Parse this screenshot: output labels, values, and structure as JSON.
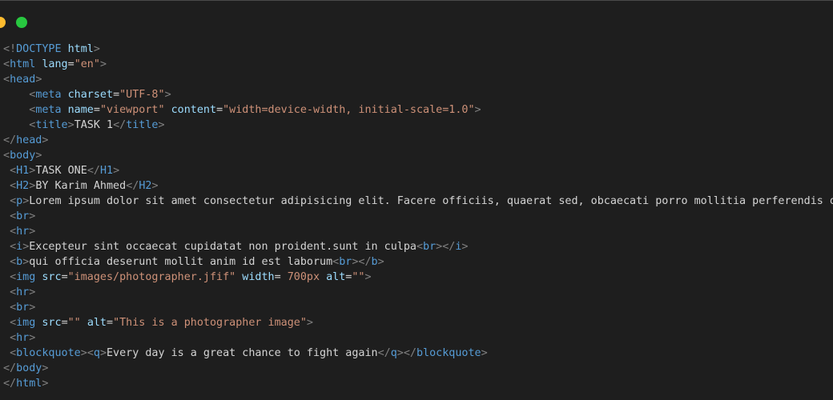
{
  "window": {
    "controls": [
      "minimize-control",
      "zoom-control"
    ]
  },
  "code": {
    "lines": [
      "<!DOCTYPE html>",
      "<html lang=\"en\">",
      "<head>",
      "    <meta charset=\"UTF-8\">",
      "    <meta name=\"viewport\" content=\"width=device-width, initial-scale=1.0\">",
      "    <title>TASK 1</title>",
      "</head>",
      "<body>",
      " <H1>TASK ONE</H1>",
      " <H2>BY Karim Ahmed</H2>",
      " <p>Lorem ipsum dolor sit amet consectetur adipisicing elit. Facere officiis, quaerat sed, obcaecati porro mollitia perferendis odit qu",
      " <br>",
      " <hr>",
      " <i>Excepteur sint occaecat cupidatat non proident.sunt in culpa<br></i>",
      " <b>qui officia deserunt mollit anim id est laborum<br></b>",
      " <img src=\"images/photographer.jfif\" width= 700px alt=\"\">",
      " <hr>",
      " <br>",
      " <img src=\"\" alt=\"This is a photographer image\">",
      " <hr>",
      " <blockquote><q>Every day is a great chance to fight again</q></blockquote>",
      "</body>",
      "</html>"
    ]
  },
  "colors": {
    "background": "#1e1e1e",
    "punctuation": "#808080",
    "tag": "#569cd6",
    "attribute": "#9cdcfe",
    "string": "#ce9178",
    "text": "#d4d4d4",
    "yellow_dot": "#febc2e",
    "green_dot": "#28c840"
  }
}
